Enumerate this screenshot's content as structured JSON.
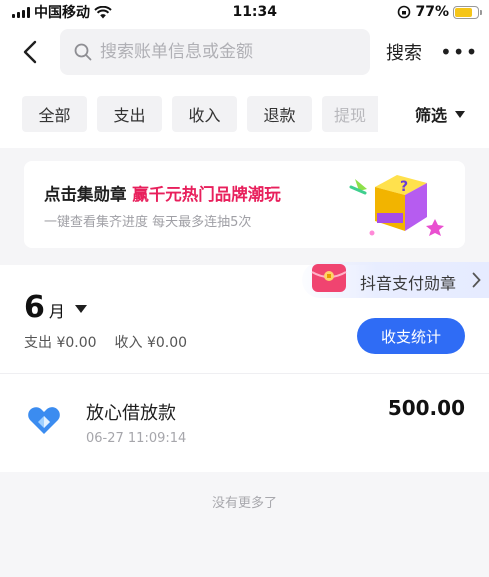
{
  "status_bar": {
    "carrier": "中国移动",
    "time": "11:34",
    "battery_percent": "77%",
    "battery_level": 0.77,
    "battery_color": "#f5c518"
  },
  "search": {
    "placeholder": "搜索账单信息或金额",
    "search_label": "搜索",
    "more_label": "•••"
  },
  "filters": {
    "chips": [
      "全部",
      "支出",
      "收入",
      "退款",
      "提现"
    ],
    "filter_label": "筛选"
  },
  "promo": {
    "title_main": "点击集勋章 ",
    "title_accent": "赢千元热门品牌潮玩",
    "subtitle": "一键查看集齐进度 每天最多连抽5次",
    "accent_color": "#e8205c"
  },
  "badge": {
    "label": "抖音支付勋章"
  },
  "month": {
    "number": "6",
    "unit": "月",
    "expense": "支出 ¥0.00",
    "income": "收入 ¥0.00",
    "stats_button": "收支统计",
    "button_color": "#2f6cf5"
  },
  "transactions": [
    {
      "title": "放心借放款",
      "time": "06-27 11:09:14",
      "amount": "500.00",
      "icon": "fangxinjie-logo-icon"
    }
  ],
  "footer": {
    "no_more": "没有更多了"
  }
}
